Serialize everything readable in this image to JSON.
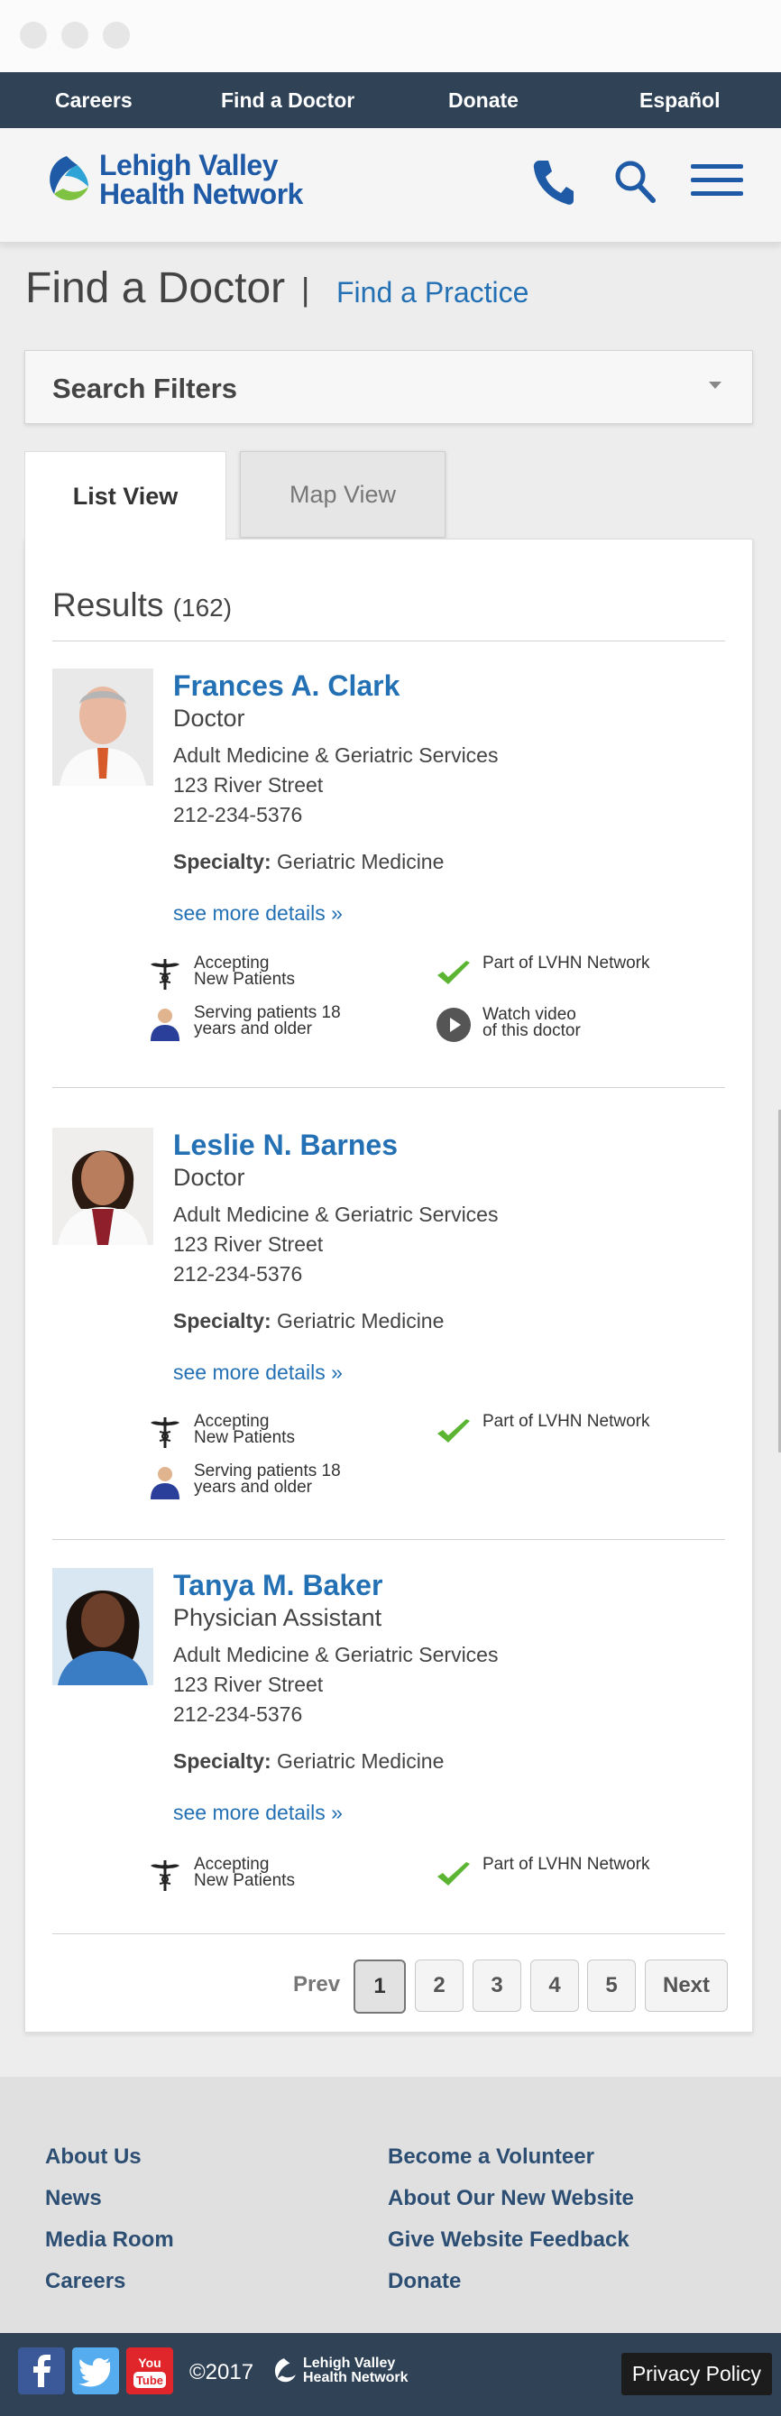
{
  "topnav": {
    "items": [
      "Careers",
      "Find a Doctor",
      "Donate",
      "Español"
    ]
  },
  "header": {
    "logo_line1": "Lehigh Valley",
    "logo_line2": "Health Network"
  },
  "page": {
    "title": "Find a Doctor",
    "separator": "|",
    "practice_link": "Find a Practice"
  },
  "filters": {
    "label": "Search Filters"
  },
  "tabs": {
    "list": "List View",
    "map": "Map View"
  },
  "results": {
    "label": "Results",
    "count": "(162)"
  },
  "doctors": [
    {
      "name": "Frances A. Clark",
      "role": "Doctor",
      "dept": "Adult Medicine & Geriatric Services",
      "address": "123 River Street",
      "phone": "212-234-5376",
      "specialty_label": "Specialty:",
      "specialty": "Geriatric Medicine",
      "details": "see more details »",
      "badges": {
        "accepting1": "Accepting",
        "accepting2": "New Patients",
        "network": "Part of LVHN Network",
        "serving1": "Serving patients 18",
        "serving2": "years and older",
        "video1": "Watch video",
        "video2": "of this doctor"
      }
    },
    {
      "name": "Leslie N. Barnes",
      "role": "Doctor",
      "dept": "Adult Medicine & Geriatric Services",
      "address": "123 River Street",
      "phone": "212-234-5376",
      "specialty_label": "Specialty:",
      "specialty": "Geriatric Medicine",
      "details": "see more details »",
      "badges": {
        "accepting1": "Accepting",
        "accepting2": "New Patients",
        "network": "Part of LVHN Network",
        "serving1": "Serving patients 18",
        "serving2": "years and older"
      }
    },
    {
      "name": "Tanya M. Baker",
      "role": "Physician Assistant",
      "dept": "Adult Medicine & Geriatric Services",
      "address": "123 River Street",
      "phone": "212-234-5376",
      "specialty_label": "Specialty:",
      "specialty": "Geriatric Medicine",
      "details": "see more details »",
      "badges": {
        "accepting1": "Accepting",
        "accepting2": "New Patients",
        "network": "Part of LVHN Network"
      }
    }
  ],
  "pagination": {
    "prev": "Prev",
    "pages": [
      "1",
      "2",
      "3",
      "4",
      "5"
    ],
    "next": "Next",
    "active": "1"
  },
  "footer": {
    "left": [
      "About Us",
      "News",
      "Media Room",
      "Careers"
    ],
    "right": [
      "Become a Volunteer",
      "About Our New Website",
      "Give Website Feedback",
      "Donate"
    ]
  },
  "bottom": {
    "copyright": "©2017",
    "logo_line1": "Lehigh Valley",
    "logo_line2": "Health Network",
    "privacy": "Privacy Policy",
    "youtube_1": "You",
    "youtube_2": "Tube"
  },
  "colors": {
    "nav_bg": "#2f4256",
    "link_blue": "#2370b4",
    "logo_blue": "#1f5aa6",
    "logo_green": "#7fc241",
    "footer_link": "#2d4e73"
  },
  "icons": [
    "phone-icon",
    "search-icon",
    "menu-icon",
    "caduceus-icon",
    "checkmark-icon",
    "person-icon",
    "play-icon",
    "facebook-icon",
    "twitter-icon",
    "youtube-icon"
  ]
}
